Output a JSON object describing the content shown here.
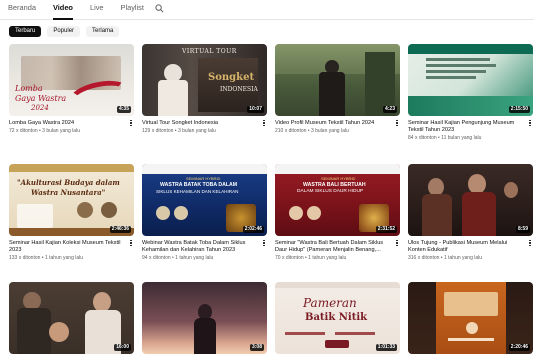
{
  "tabs": [
    {
      "label": "Beranda",
      "active": false
    },
    {
      "label": "Video",
      "active": true
    },
    {
      "label": "Live",
      "active": false
    },
    {
      "label": "Playlist",
      "active": false
    }
  ],
  "search_icon": "search-icon",
  "chips": [
    {
      "label": "Terbaru",
      "active": true
    },
    {
      "label": "Populer",
      "active": false
    },
    {
      "label": "Terlama",
      "active": false
    }
  ],
  "videos": [
    {
      "title": "Lomba Gaya Wastra 2024",
      "stats": "72 x ditonton • 3 bulan yang lalu",
      "duration": "4:35",
      "thumb_text": [
        "Lomba",
        "Gaya Wastra",
        "2024"
      ]
    },
    {
      "title": "Virtual Tour Songket Indonesia",
      "stats": "129 x ditonton • 3 bulan yang lalu",
      "duration": "10:07",
      "thumb_text": [
        "VIRTUAL TOUR",
        "Songket",
        "INDONESIA"
      ]
    },
    {
      "title": "Video Profil Museum Tekstil Tahun 2024",
      "stats": "210 x ditonton • 3 bulan yang lalu",
      "duration": "4:23",
      "thumb_text": []
    },
    {
      "title": "Seminar Hasil Kajian Pengunjung Museum Tekstil Tahun 2023",
      "stats": "84 x ditonton • 11 bulan yang lalu",
      "duration": "2:15:50",
      "thumb_text": []
    },
    {
      "title": "Seminar Hasil Kajian Koleksi Museum Tekstil 2023",
      "stats": "133 x ditonton • 1 tahun yang lalu",
      "duration": "2:46:36",
      "thumb_text": [
        "\"Akulturasi Budaya dalam",
        "Wastra Nusantara\""
      ]
    },
    {
      "title": "Webinar Wastra Batak Toba Dalam Siklus Kehamilan dan Kelahiran Tahun 2023",
      "stats": "94 x ditonton • 1 tahun yang lalu",
      "duration": "2:02:46",
      "thumb_text": [
        "SEMINAR HYBRID",
        "WASTRA BATAK TOBA DALAM",
        "SIKLUS KEHAMILAN DAN KELAHIRAN"
      ]
    },
    {
      "title": "Seminar \"Wastra Bali Bertuah Dalam Siklus Daur Hidup\" (Pameran Menjalin Benang,...",
      "stats": "70 x ditonton • 1 tahun yang lalu",
      "duration": "2:31:52",
      "thumb_text": [
        "SEMINAR HYBRID",
        "WASTRA BALI BERTUAH",
        "DALAM SIKLUS DAUR HIDUP"
      ]
    },
    {
      "title": "Ulos Tujung - Publikasi Museum Melalui Konten Edukatif",
      "stats": "316 x ditonton • 1 tahun yang lalu",
      "duration": "8:59",
      "thumb_text": []
    },
    {
      "title": "",
      "stats": "",
      "duration": "16:00",
      "thumb_text": []
    },
    {
      "title": "",
      "stats": "",
      "duration": "3:08",
      "thumb_text": []
    },
    {
      "title": "",
      "stats": "",
      "duration": "1:01:33",
      "thumb_text": [
        "Pameran",
        "Batik Nitik"
      ]
    },
    {
      "title": "",
      "stats": "",
      "duration": "2:20:46",
      "thumb_text": []
    }
  ]
}
